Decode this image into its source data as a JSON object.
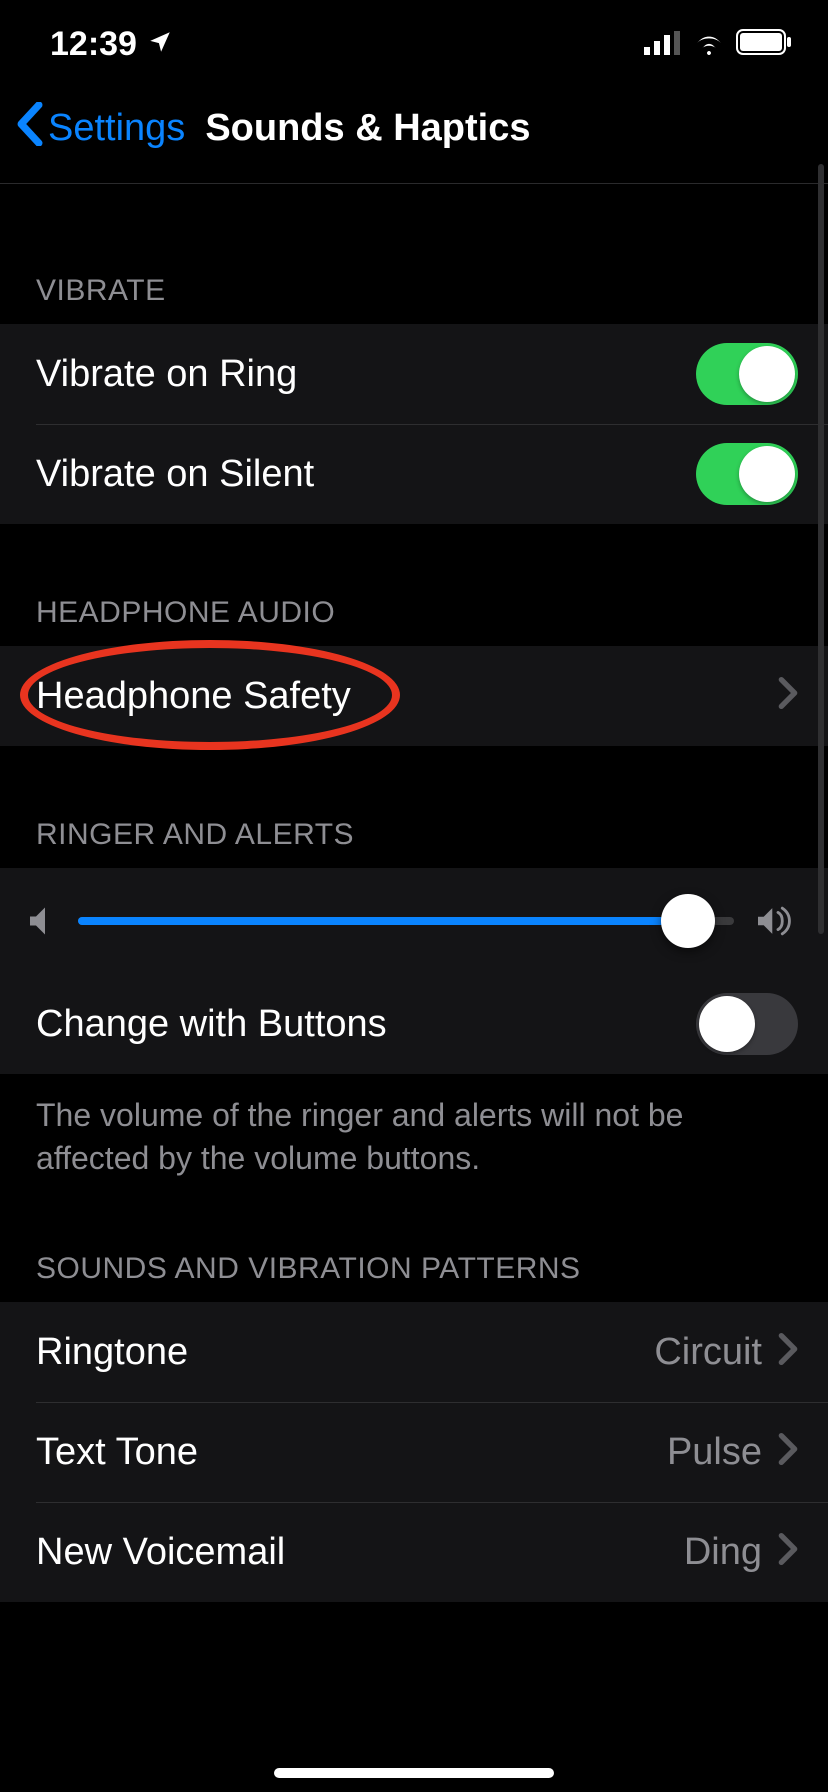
{
  "status_bar": {
    "time": "12:39"
  },
  "nav": {
    "back_label": "Settings",
    "title": "Sounds & Haptics"
  },
  "sections": {
    "vibrate": {
      "header": "VIBRATE",
      "rows": [
        {
          "label": "Vibrate on Ring",
          "toggled": true
        },
        {
          "label": "Vibrate on Silent",
          "toggled": true
        }
      ]
    },
    "headphone_audio": {
      "header": "HEADPHONE AUDIO",
      "rows": [
        {
          "label": "Headphone Safety"
        }
      ]
    },
    "ringer_alerts": {
      "header": "RINGER AND ALERTS",
      "slider": {
        "value_pct": 93
      },
      "change_buttons": {
        "label": "Change with Buttons",
        "toggled": false
      },
      "footer": "The volume of the ringer and alerts will not be affected by the volume buttons."
    },
    "sounds_patterns": {
      "header": "SOUNDS AND VIBRATION PATTERNS",
      "rows": [
        {
          "label": "Ringtone",
          "value": "Circuit"
        },
        {
          "label": "Text Tone",
          "value": "Pulse"
        },
        {
          "label": "New Voicemail",
          "value": "Ding"
        }
      ]
    }
  },
  "annotation": {
    "highlighted_item": "Headphone Safety",
    "color": "#e8341f"
  }
}
